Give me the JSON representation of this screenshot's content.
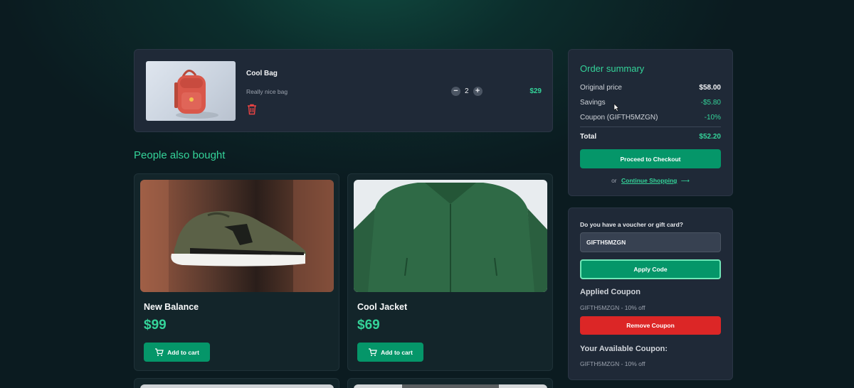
{
  "cart": {
    "items": [
      {
        "name": "Cool Bag",
        "description": "Really nice bag",
        "quantity": "2",
        "price": "$29",
        "image": "red-backpack-photo"
      }
    ],
    "icons": {
      "delete": "trash-icon",
      "decrease": "minus-icon",
      "increase": "plus-icon"
    }
  },
  "recommendations": {
    "title": "People also bought",
    "products": [
      {
        "name": "New Balance",
        "price": "$99",
        "button": "Add to cart",
        "image": "olive-sneaker-photo"
      },
      {
        "name": "Cool Jacket",
        "price": "$69",
        "button": "Add to cart",
        "image": "green-jacket-photo"
      }
    ]
  },
  "summary": {
    "title": "Order summary",
    "rows": [
      {
        "label": "Original price",
        "value": "$58.00"
      },
      {
        "label": "Savings",
        "value": "-$5.80"
      },
      {
        "label": "Coupon (GIFTH5MZGN)",
        "value": "-10%"
      }
    ],
    "total_label": "Total",
    "total_value": "$52.20",
    "checkout_label": "Proceed to Checkout",
    "or_text": "or",
    "continue_label": "Continue Shopping"
  },
  "voucher": {
    "question": "Do you have a voucher or gift card?",
    "input_value": "GIFTH5MZGN",
    "apply_label": "Apply Code",
    "applied_heading": "Applied Coupon",
    "applied_text": "GIFTH5MZGN - 10% off",
    "remove_label": "Remove Coupon",
    "available_heading": "Your Available Coupon:",
    "available_text": "GIFTH5MZGN - 10% off"
  },
  "colors": {
    "accent": "#34d399",
    "button": "#059669",
    "danger": "#dc2626",
    "panel": "#1f2937"
  }
}
